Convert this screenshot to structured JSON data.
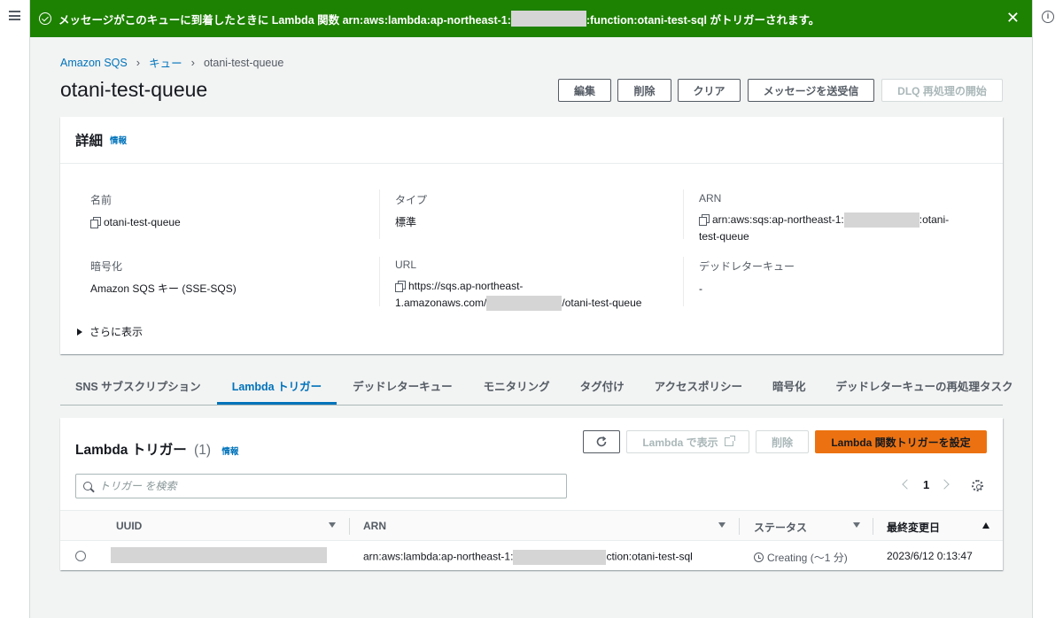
{
  "flash": {
    "message_prefix": "メッセージがこのキューに到着したときに Lambda 関数 arn:aws:lambda:ap-northeast-1:",
    "message_suffix": ":function:otani-test-sql がトリガーされます。",
    "close": "✕"
  },
  "breadcrumb": {
    "item1": "Amazon SQS",
    "item2": "キュー",
    "current": "otani-test-queue"
  },
  "page_title": "otani-test-queue",
  "header_buttons": {
    "edit": "編集",
    "delete": "削除",
    "purge": "クリア",
    "send_receive": "メッセージを送受信",
    "dlq_redrive": "DLQ 再処理の開始"
  },
  "details": {
    "title": "詳細",
    "info": "情報",
    "name_label": "名前",
    "name_value": "otani-test-queue",
    "type_label": "タイプ",
    "type_value": "標準",
    "arn_label": "ARN",
    "arn_prefix": "arn:aws:sqs:ap-northeast-1:",
    "arn_suffix": ":otani-",
    "arn_line2": "test-queue",
    "encryption_label": "暗号化",
    "encryption_value": "Amazon SQS キー (SSE-SQS)",
    "url_label": "URL",
    "url_line1": "https://sqs.ap-northeast-",
    "url_line2_prefix": "1.amazonaws.com/",
    "url_line2_suffix": "/otani-test-queue",
    "dlq_label": "デッドレターキュー",
    "dlq_value": "-",
    "show_more": "さらに表示"
  },
  "tabs": [
    {
      "label": "SNS サブスクリプション"
    },
    {
      "label": "Lambda トリガー"
    },
    {
      "label": "デッドレターキュー"
    },
    {
      "label": "モニタリング"
    },
    {
      "label": "タグ付け"
    },
    {
      "label": "アクセスポリシー"
    },
    {
      "label": "暗号化"
    },
    {
      "label": "デッドレターキューの再処理タスク"
    }
  ],
  "triggers": {
    "title": "Lambda トリガー",
    "count": "(1)",
    "info": "情報",
    "view_in_lambda": "Lambda で表示",
    "delete": "削除",
    "configure": "Lambda 関数トリガーを設定",
    "search_placeholder": "トリガー を検索",
    "page": "1",
    "columns": [
      "UUID",
      "ARN",
      "ステータス",
      "最終変更日"
    ],
    "row": {
      "arn_prefix": "arn:aws:lambda:ap-northeast-1:",
      "arn_suffix": "ction:otani-test-sql",
      "status": "Creating (〜1 分)",
      "modified": "2023/6/12 0:13:47"
    }
  },
  "colors": {
    "success": "#1d8102",
    "link": "#0073bb",
    "primary": "#ec7211",
    "background": "#f2f3f3"
  }
}
